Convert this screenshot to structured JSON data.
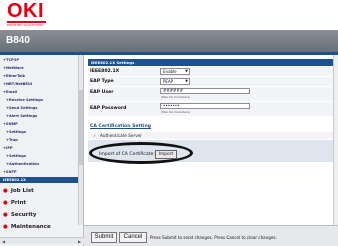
{
  "brand": {
    "logo_text": "OKI",
    "tagline": "PRINTING SOLUTIONS",
    "accent": "#e60012",
    "nav_blue": "#1e4f8f"
  },
  "model_title": "B840",
  "sidebar": {
    "items": [
      {
        "label": "+TCP/IP",
        "level": 0
      },
      {
        "label": "+NetWare",
        "level": 0
      },
      {
        "label": "+EtherTalk",
        "level": 0
      },
      {
        "label": "+NBT/NetBEUI",
        "level": 0
      },
      {
        "label": "+Email",
        "level": 0
      },
      {
        "label": "+Receive Settings",
        "level": 1
      },
      {
        "label": "+Send Settings",
        "level": 1
      },
      {
        "label": "+Alert Settings",
        "level": 1
      },
      {
        "label": "+SNMP",
        "level": 0
      },
      {
        "label": "+Settings",
        "level": 1
      },
      {
        "label": "+Trap",
        "level": 1
      },
      {
        "label": "+IPP",
        "level": 0
      },
      {
        "label": "+Settings",
        "level": 1
      },
      {
        "label": "+Authentication",
        "level": 1
      },
      {
        "label": "+SNTP",
        "level": 0
      },
      {
        "label": "IEEE802.1X",
        "level": 0,
        "active": true
      }
    ],
    "sections": [
      "Job List",
      "Print",
      "Security",
      "Maintenance"
    ]
  },
  "main": {
    "section_title": "IEEE802.1X Settings",
    "rows": [
      {
        "label": "IEEE802.1X",
        "type": "select",
        "value": "Enable"
      },
      {
        "label": "EAP Type",
        "type": "select",
        "value": "PEAP"
      },
      {
        "label": "EAP User",
        "type": "text",
        "value": "######",
        "hint": "(Max 64 characters)"
      },
      {
        "label": "EAP Password",
        "type": "password",
        "value": "•••••••",
        "hint": "(Max 64 characters)"
      }
    ],
    "ca_section_link": "CA Certification Setting",
    "authenticate_server": {
      "label": "Authenticate Server",
      "checked": true
    },
    "import_ca": {
      "label": "Import of CA Certificate:",
      "button_label": "Import"
    }
  },
  "footer": {
    "submit_label": "Submit",
    "cancel_label": "Cancel",
    "message": "Press Submit to send changes. Press Cancel to clear changes."
  }
}
